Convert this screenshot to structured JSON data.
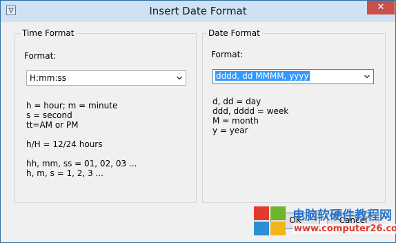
{
  "window": {
    "title": "Insert Date Format",
    "close_glyph": "✕",
    "title_icon": "app-icon",
    "titlebar_color": "#cfe1f3",
    "close_color": "#c7504b"
  },
  "time_group": {
    "title": "Time Format",
    "format_label": "Format:",
    "combo_value": "H:mm:ss",
    "help": [
      "h = hour; m = minute",
      "s = second",
      "tt=AM or PM",
      "h/H = 12/24 hours",
      "hh, mm, ss = 01, 02, 03 ...",
      "h, m, s = 1, 2, 3 ..."
    ]
  },
  "date_group": {
    "title": "Date Format",
    "format_label": "Format:",
    "combo_value": "dddd, dd MMMM, yyyy",
    "help": [
      "d, dd = day",
      "ddd, dddd = week",
      "M = month",
      "y = year"
    ]
  },
  "buttons": {
    "ok_label": "OK",
    "cancel_label": "Cancel"
  },
  "watermark": {
    "title": "电脑软硬件教程网",
    "url": "www.computer26.com",
    "colors": [
      "#e23a2c",
      "#6fb52c",
      "#2a8fd6",
      "#f3b51b"
    ]
  }
}
